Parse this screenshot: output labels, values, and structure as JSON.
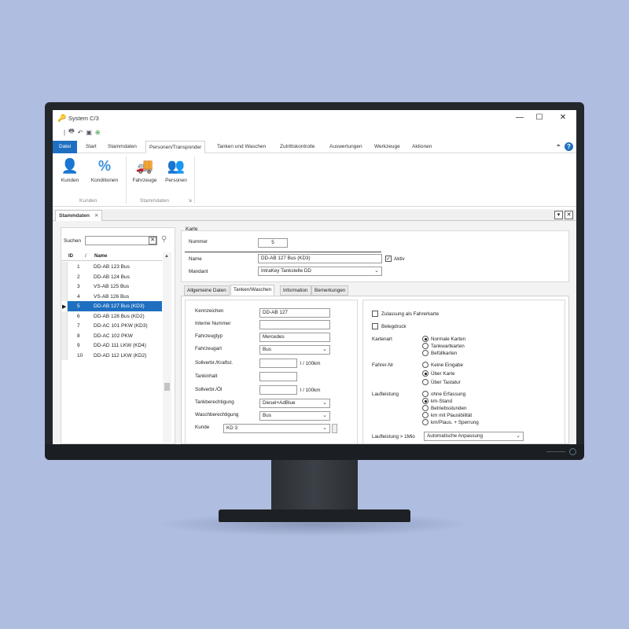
{
  "window": {
    "title": "System C/3",
    "close": "✕",
    "maximize": "☐",
    "minimize": "—"
  },
  "ribbon_tabs": [
    "Datei",
    "Start",
    "Stammdaten",
    "Personen/Transponder",
    "Tanken und Waschen",
    "Zutrittskontrolle",
    "Auswertungen",
    "Werkzeuge",
    "Aktionen"
  ],
  "ribbon": {
    "kunden": "Kunden",
    "konditionen": "Konditionen",
    "fahrzeuge": "Fahrzeuge",
    "personen": "Personen",
    "group_kunden": "Kunden",
    "group_stammdaten": "Stammdaten"
  },
  "doc_tab": "Stammdaten",
  "list": {
    "search_label": "Suchen",
    "headers": {
      "id": "ID",
      "sort": "/",
      "name": "Name"
    },
    "rows": [
      {
        "id": "1",
        "name": "DD-AB 123 Bus"
      },
      {
        "id": "2",
        "name": "DD-AB 124 Bus"
      },
      {
        "id": "3",
        "name": "VS-AB 125 Bus"
      },
      {
        "id": "4",
        "name": "VS-AB 126 Bus"
      },
      {
        "id": "5",
        "name": "DD-AB 127 Bus (KD3)"
      },
      {
        "id": "6",
        "name": "DD-AB 128 Bus (KD2)"
      },
      {
        "id": "7",
        "name": "DD-AC 101 PKW (KD3)"
      },
      {
        "id": "8",
        "name": "DD-AC 102 PKW"
      },
      {
        "id": "9",
        "name": "DD-AD 111 LKW (KD4)"
      },
      {
        "id": "10",
        "name": "DD-AD 112 LKW (KD2)"
      }
    ],
    "selected_index": 4
  },
  "karte": {
    "title": "Karte",
    "nummer_label": "Nummer",
    "nummer_value": "5",
    "name_label": "Name",
    "name_value": "DD-AB 127 Bus (KD3)",
    "aktiv_label": "Aktiv",
    "mandant_label": "Mandant",
    "mandant_value": "IntraKey Tankstelle DD"
  },
  "form_tabs": [
    "Allgemeine Daten",
    "Tanken/Waschen",
    "Information",
    "Bemerkungen"
  ],
  "tanken": {
    "kennzeichen_label": "Kennzeichen",
    "kennzeichen_value": "DD-AB 127",
    "interne_nummer_label": "Interne Nummer",
    "fahrzeugtyp_label": "Fahrzeugtyp",
    "fahrzeugtyp_value": "Mercedes",
    "fahrzeugart_label": "Fahrzeugart",
    "fahrzeugart_value": "Bus",
    "sollverbr_kraftst_label": "Sollverbr./Kraftst.",
    "unit1": "l / 100km",
    "tankinhalt_label": "Tankinhalt",
    "sollverbr_oel_label": "Sollverbr./Öl",
    "unit2": "l / 100km",
    "tankberechtigung_label": "Tankberechtigung",
    "tankberechtigung_value": "Diesel+AdBlue",
    "waschberechtigung_label": "Waschberechtigung",
    "waschberechtigung_value": "Bus",
    "kunde_label": "Kunde",
    "kunde_value": "KD 3"
  },
  "right": {
    "zulassung_label": "Zulassung als Fahrerkarte",
    "belegdruck_label": "Belegdruck",
    "kartenart_label": "Kartenart",
    "kartenart_options": [
      "Normale Karten",
      "Tankwartkarten",
      "Befüllkarten"
    ],
    "fahrer_nr_label": "Fahrer-Nr",
    "fahrer_nr_options": [
      "Keine Eingabe",
      "Über Karte",
      "Über Tastatur"
    ],
    "laufleistung_label": "Laufleistung",
    "laufleistung_options": [
      "ohne Erfassung",
      "km-Stand",
      "Betriebsstunden",
      "km mit Plausibilität",
      "km/Plaus. + Sperrung"
    ],
    "laufleistung_mio_label": "Laufleistung > 1Mio",
    "laufleistung_mio_value": "Automatische Anpassung"
  }
}
